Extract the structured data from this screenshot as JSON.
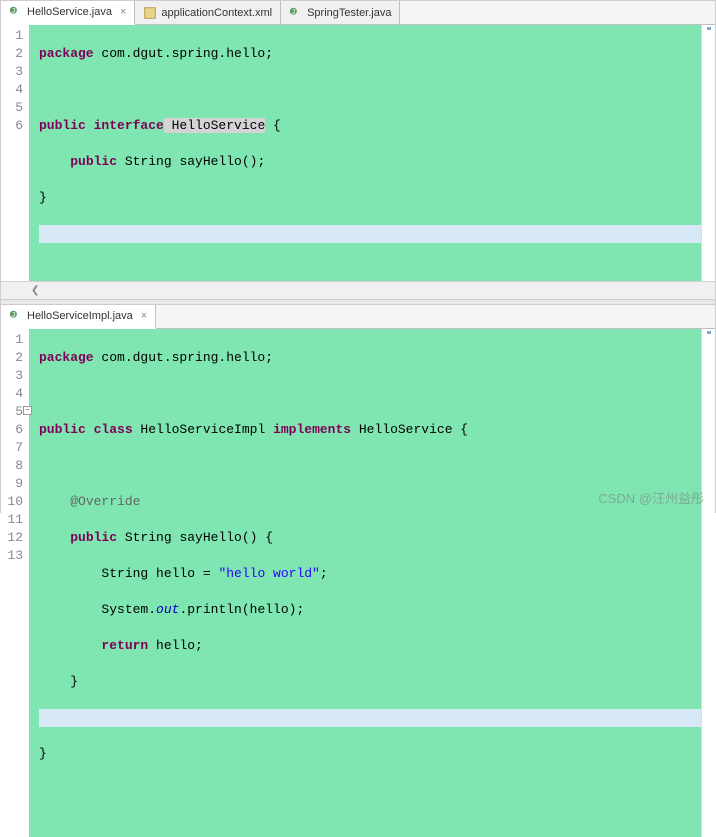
{
  "pane1": {
    "tabs": [
      {
        "label": "HelloService.java",
        "active": true,
        "icon": "java",
        "closeable": true
      },
      {
        "label": "applicationContext.xml",
        "active": false,
        "icon": "xml",
        "closeable": false
      },
      {
        "label": "SpringTester.java",
        "active": false,
        "icon": "java",
        "closeable": false
      }
    ],
    "line_numbers": [
      "1",
      "2",
      "3",
      "4",
      "5",
      "6"
    ],
    "code": {
      "l1_pkg": "package",
      "l1_rest": " com.dgut.spring.hello;",
      "l3_pub": "public",
      "l3_int": " interface",
      "l3_name": " HelloService",
      "l3_rest": " {",
      "l4_indent": "    ",
      "l4_pub": "public",
      "l4_rest": " String sayHello();",
      "l5": "}"
    }
  },
  "pane2": {
    "tabs": [
      {
        "label": "HelloServiceImpl.java",
        "active": true,
        "icon": "java",
        "closeable": true
      }
    ],
    "line_numbers": [
      "1",
      "2",
      "3",
      "4",
      "5",
      "6",
      "7",
      "8",
      "9",
      "10",
      "11",
      "12",
      "13"
    ],
    "code": {
      "l1_pkg": "package",
      "l1_rest": " com.dgut.spring.hello;",
      "l3_pub": "public",
      "l3_cls": " class",
      "l3_name": " HelloServiceImpl ",
      "l3_impl": "implements",
      "l3_rest": " HelloService {",
      "l5_indent": "    ",
      "l5_ann": "@Override",
      "l6_indent": "    ",
      "l6_pub": "public",
      "l6_rest": " String sayHello() {",
      "l7_indent": "        String hello = ",
      "l7_str": "\"hello world\"",
      "l7_rest": ";",
      "l8_indent": "        System.",
      "l8_out": "out",
      "l8_rest": ".println(hello);",
      "l9_indent": "        ",
      "l9_ret": "return",
      "l9_rest": " hello;",
      "l10": "    }",
      "l12": "}"
    }
  },
  "watermark": "CSDN @汪州益彤"
}
